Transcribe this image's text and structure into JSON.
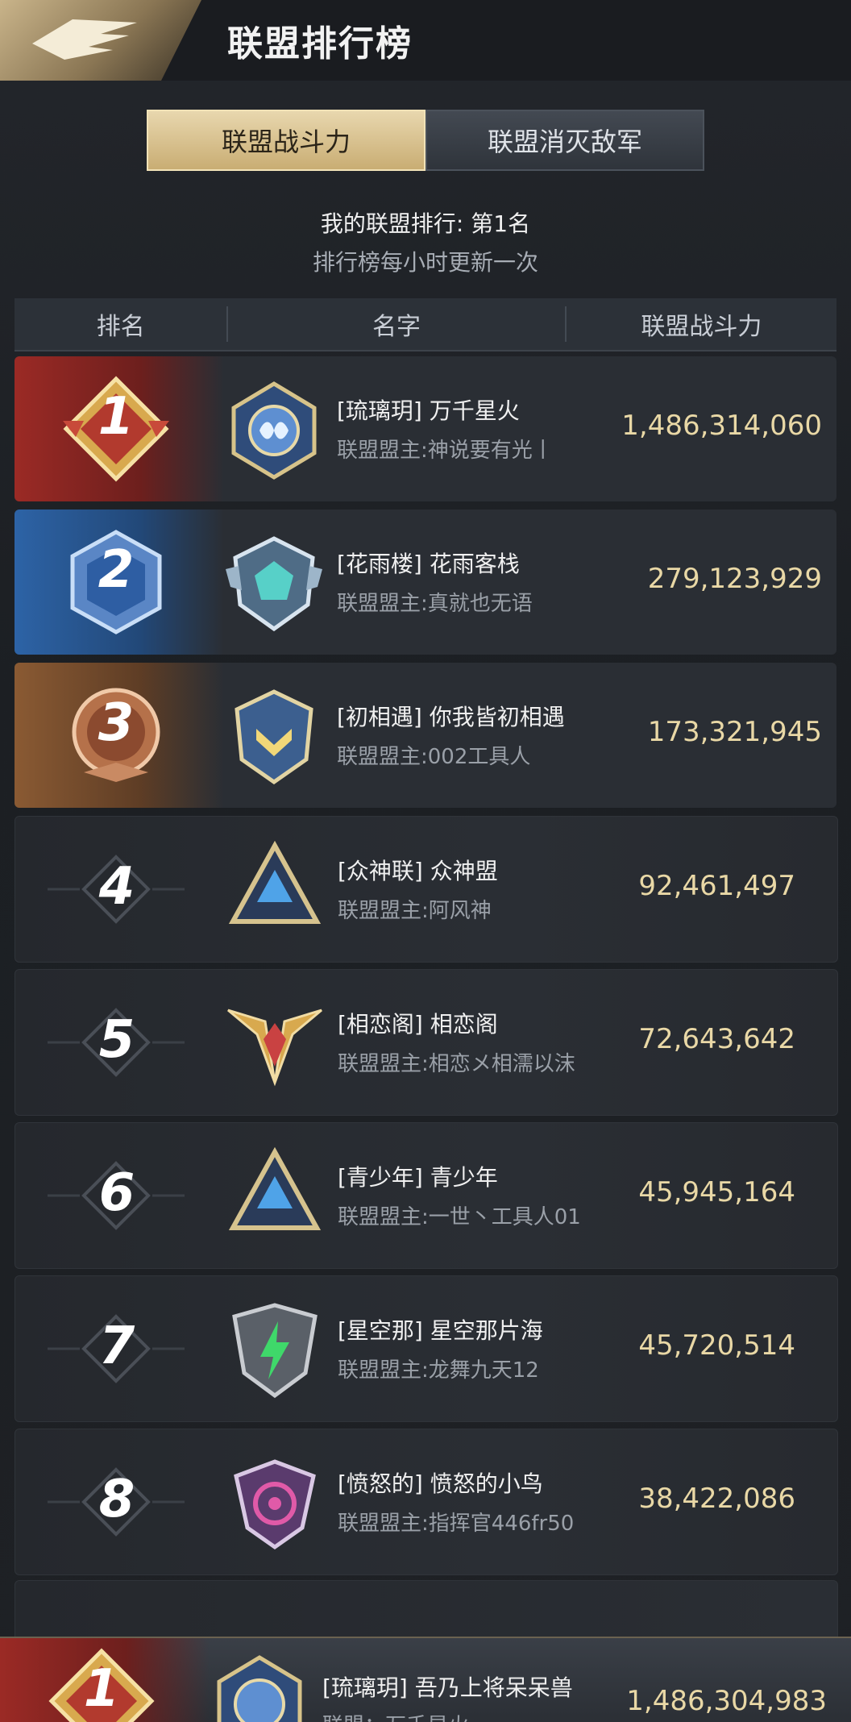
{
  "header": {
    "title": "联盟排行榜"
  },
  "tabs": [
    {
      "label": "联盟战斗力",
      "active": true
    },
    {
      "label": "联盟消灭敌军",
      "active": false
    }
  ],
  "info": {
    "my_rank": "我的联盟排行: 第1名",
    "update_note": "排行榜每小时更新一次"
  },
  "table": {
    "headers": {
      "rank": "排名",
      "name": "名字",
      "power": "联盟战斗力"
    },
    "rows": [
      {
        "rank": "1",
        "name": "[琉璃玥] 万千星火",
        "leader": "联盟盟主:神说要有光丨",
        "power": "1,486,314,060"
      },
      {
        "rank": "2",
        "name": "[花雨楼] 花雨客栈",
        "leader": "联盟盟主:真就也无语",
        "power": "279,123,929"
      },
      {
        "rank": "3",
        "name": "[初相遇] 你我皆初相遇",
        "leader": "联盟盟主:002工具人",
        "power": "173,321,945"
      },
      {
        "rank": "4",
        "name": "[众神联] 众神盟",
        "leader": "联盟盟主:阿风神",
        "power": "92,461,497"
      },
      {
        "rank": "5",
        "name": "[相恋阁] 相恋阁",
        "leader": "联盟盟主:相恋メ相濡以沫",
        "power": "72,643,642"
      },
      {
        "rank": "6",
        "name": "[青少年] 青少年",
        "leader": "联盟盟主:一世丶工具人01",
        "power": "45,945,164"
      },
      {
        "rank": "7",
        "name": "[星空那] 星空那片海",
        "leader": "联盟盟主:龙舞九天12",
        "power": "45,720,514"
      },
      {
        "rank": "8",
        "name": "[愤怒的] 愤怒的小鸟",
        "leader": "联盟盟主:指挥官446fr50",
        "power": "38,422,086"
      }
    ]
  },
  "self_bar": {
    "rank": "1",
    "name": "[琉璃玥] 吾乃上将呆呆兽",
    "leader": "联盟：万千星火",
    "power": "1,486,304,983"
  },
  "colors": {
    "gold_accent": "#c9ad73",
    "rank1": "#9b2a25",
    "rank2": "#2d63a6",
    "rank3": "#8a5a33",
    "power_text": "#e9d8a6"
  },
  "icons": {
    "logo": "eagle-wing-icon",
    "rank_badges": [
      "rank-1-badge-icon",
      "rank-2-badge-icon",
      "rank-3-badge-icon"
    ],
    "emblems": [
      "alliance-emblem-icon"
    ]
  }
}
